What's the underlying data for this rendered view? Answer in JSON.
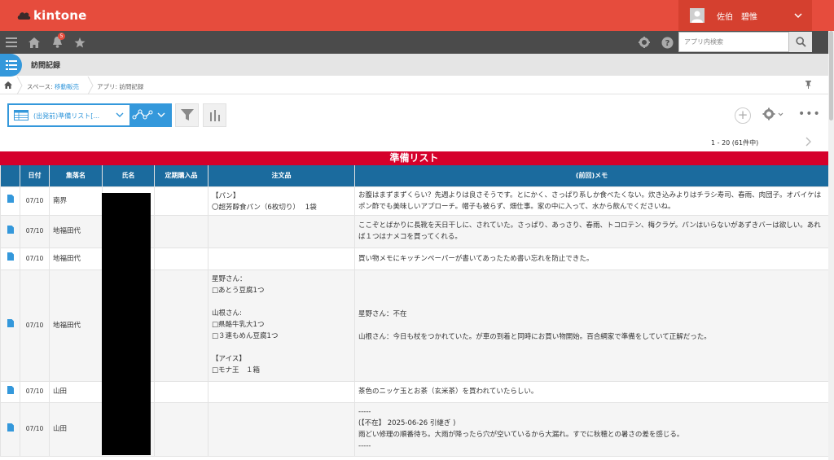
{
  "header": {
    "logo_text": "kintone",
    "user_name": "佐伯　碧惟"
  },
  "toolbar": {
    "notification_count": "5",
    "search_placeholder": "アプリ内検索"
  },
  "app": {
    "title": "訪問記録"
  },
  "breadcrumb": {
    "space_prefix": "スペース: ",
    "space_name": "移動販売",
    "app_label": "アプリ: 訪問記録"
  },
  "view": {
    "selected_view": "(出発前)準備リスト[...",
    "pager": "1 - 20  (61件中)"
  },
  "list": {
    "title": "準備リスト",
    "columns": [
      "日付",
      "集落名",
      "氏名",
      "定期購入品",
      "注文品",
      "(前回)メモ"
    ],
    "rows": [
      {
        "date": "07/10",
        "village": "南界",
        "order": "【パン】\n〇超芳醇食パン（6枚切り）　 1袋",
        "memo": "お腹はまずまずくらい？先週よりは良さそうです。とにかく、さっぱり系しか食べたくない。炊き込みよりはチラシ寿司、春雨、肉団子。オバイケはポン酢でも美味しいアプローチ。帽子も被らず、畑仕事。家の中に入って、水から飲んでくださいね。"
      },
      {
        "date": "07/10",
        "village": "地福田代",
        "order": "",
        "memo": "ここぞとばかりに長靴を天日干しに、されていた。さっぱり、あっさり、春雨、トコロテン、梅クラゲ。パンはいらないがあずきバーは欲しい。あれば１つはナメコを買ってくれる。"
      },
      {
        "date": "07/10",
        "village": "地福田代",
        "order": "",
        "memo": "買い物メモにキッチンペーパーが書いてあったため書い忘れを防止できた。"
      },
      {
        "date": "07/10",
        "village": "地福田代",
        "order": "星野さん：\n□あとう豆腐1つ\n\n山根さん:\n□県酪牛乳大1つ\n□３連もめん豆腐1つ\n\n【アイス】\n□モナ王　１箱",
        "memo": "星野さん：不在\n\n山根さん：今日も杖をつかれていた。が車の到着と同時にお買い物開始。百合綱家で準備をしていて正解だった。"
      },
      {
        "date": "07/10",
        "village": "山田",
        "order": "",
        "memo": "茶色のニッケ玉とお茶（玄米茶）を買われていたらしい。"
      },
      {
        "date": "07/10",
        "village": "山田",
        "order": "",
        "memo": "-----\n(【不在】 2025-06-26 引継ぎ )\n雨どい修理の順番待ち。大雨が降ったら穴が空いているから大漏れ。すでに秋穂との暑さの差を感じる。\n-----"
      }
    ]
  },
  "colors": {
    "header_red": "#e64c3d",
    "toolbar_dark": "#4b4b4b",
    "accent_blue": "#3498db",
    "banner_red": "#d5002b",
    "table_header_blue": "#1b6b9e"
  }
}
